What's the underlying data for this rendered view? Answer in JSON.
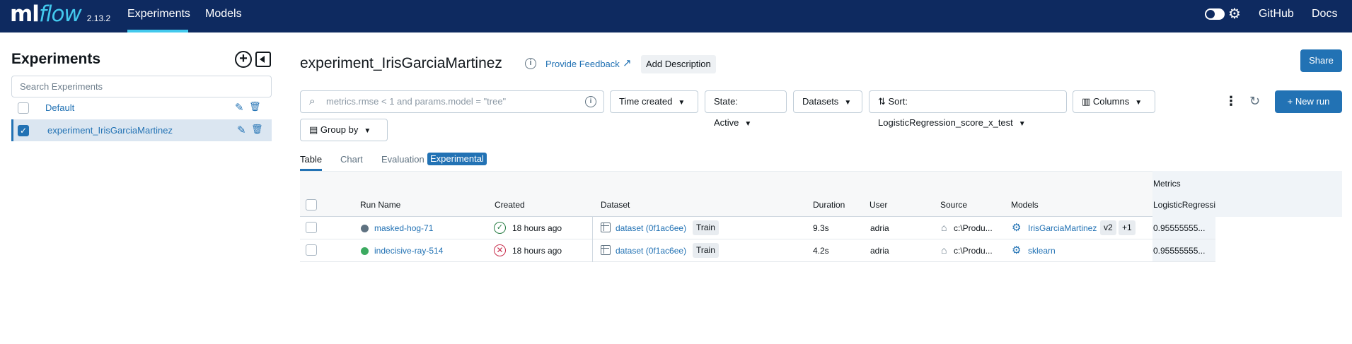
{
  "header": {
    "logo_ml": "ml",
    "logo_flow": "flow",
    "version": "2.13.2",
    "nav": {
      "experiments": "Experiments",
      "models": "Models"
    },
    "github": "GitHub",
    "docs": "Docs"
  },
  "sidebar": {
    "title": "Experiments",
    "search_placeholder": "Search Experiments",
    "experiments": [
      {
        "name": "Default",
        "checked": false
      },
      {
        "name": "experiment_IrisGarciaMartinez",
        "checked": true
      }
    ]
  },
  "main": {
    "title": "experiment_IrisGarciaMartinez",
    "provide_feedback": "Provide Feedback",
    "add_description": "Add Description",
    "share": "Share",
    "toolbar": {
      "search_placeholder": "metrics.rmse < 1 and params.model = \"tree\"",
      "time_created": "Time created",
      "state": "State: Active",
      "datasets": "Datasets",
      "sort": "Sort: LogisticRegression_score_x_test",
      "columns": "Columns",
      "group_by": "Group by",
      "new_run": "New run"
    },
    "tabs": {
      "table": "Table",
      "chart": "Chart",
      "evaluation": "Evaluation",
      "experimental_badge": "Experimental"
    },
    "table": {
      "group_header": "Metrics",
      "columns": {
        "run_name": "Run Name",
        "created": "Created",
        "dataset": "Dataset",
        "duration": "Duration",
        "user": "User",
        "source": "Source",
        "models": "Models",
        "metric": "LogisticRegressi"
      },
      "rows": [
        {
          "run_name": "masked-hog-71",
          "status_color": "#5f7281",
          "status": "success",
          "created": "18 hours ago",
          "dataset": "dataset (0f1ac6ee)",
          "dataset_tag": "Train",
          "duration": "9.3s",
          "user": "adria",
          "source": "c:\\Produ...",
          "model": "IrisGarciaMartinez",
          "model_version": "v2",
          "model_more": "+1",
          "metric": "0.95555555..."
        },
        {
          "run_name": "indecisive-ray-514",
          "status_color": "#3caa60",
          "status": "failed",
          "created": "18 hours ago",
          "dataset": "dataset (0f1ac6ee)",
          "dataset_tag": "Train",
          "duration": "4.2s",
          "user": "adria",
          "source": "c:\\Produ...",
          "model": "sklearn",
          "metric": "0.95555555..."
        }
      ]
    }
  },
  "colors": {
    "header_bg": "#0e2a60",
    "accent": "#2272b4",
    "logo_accent": "#43c9ed"
  }
}
